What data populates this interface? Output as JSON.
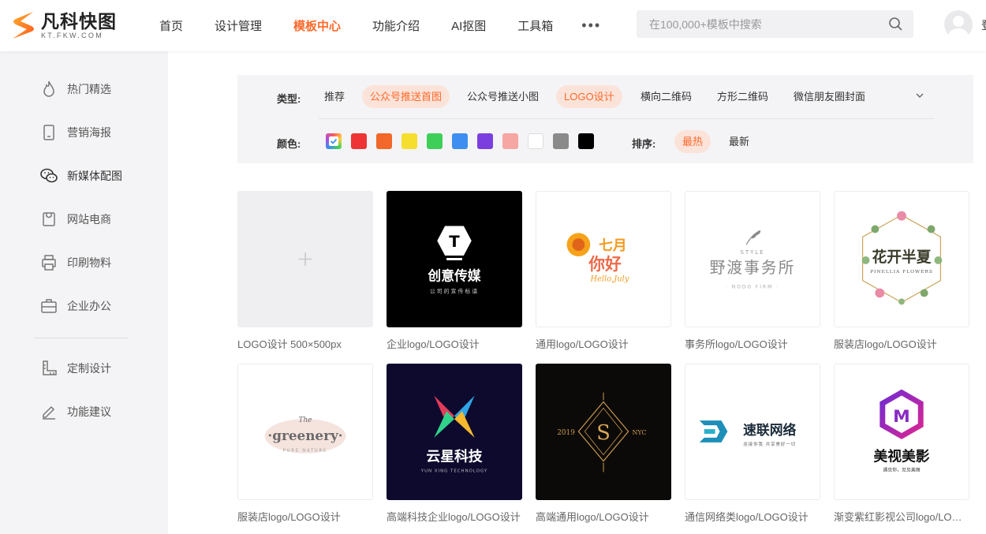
{
  "app": {
    "name": "凡科快图",
    "domain": "KT.FKW.COM",
    "brand_color": "#ff6a2b"
  },
  "nav": {
    "items": [
      "首页",
      "设计管理",
      "模板中心",
      "功能介绍",
      "AI抠图",
      "工具箱"
    ],
    "active": "模板中心",
    "more": "•••"
  },
  "search": {
    "placeholder": "在100,000+模板中搜索",
    "icon": "search-icon"
  },
  "header": {
    "tail_text": "登"
  },
  "sidebar": {
    "items": [
      {
        "label": "热门精选",
        "icon": "flame-icon"
      },
      {
        "label": "营销海报",
        "icon": "phone-icon"
      },
      {
        "label": "新媒体配图",
        "icon": "wechat-icon"
      },
      {
        "label": "网站电商",
        "icon": "shopping-bag-icon"
      },
      {
        "label": "印刷物料",
        "icon": "printer-icon"
      },
      {
        "label": "企业办公",
        "icon": "briefcase-icon"
      },
      {
        "label": "定制设计",
        "icon": "ruler-icon"
      },
      {
        "label": "功能建议",
        "icon": "pencil-icon"
      }
    ],
    "active": "新媒体配图"
  },
  "filters": {
    "type_label": "类型:",
    "types": [
      "推荐",
      "公众号推送首图",
      "公众号推送小图",
      "LOGO设计",
      "横向二维码",
      "方形二维码",
      "微信朋友圈封面"
    ],
    "selected_types": [
      "公众号推送首图",
      "LOGO设计"
    ],
    "color_label": "颜色:",
    "colors": [
      "multicolor",
      "#ee3434",
      "#f2672a",
      "#f6de2e",
      "#3ecf59",
      "#3d8ef0",
      "#7b3fe0",
      "#f6a6a3",
      "#ffffff",
      "#8a8a8a",
      "#000000"
    ],
    "sort_label": "排序:",
    "sorts": [
      "最热",
      "最新"
    ],
    "selected_sort": "最热"
  },
  "templates": [
    {
      "caption": "LOGO设计 500×500px",
      "kind": "blank"
    },
    {
      "caption": "企业logo/LOGO设计",
      "art_title": "创意传媒",
      "art_sub": "公司的宣传标语",
      "art_glyph": "T"
    },
    {
      "caption": "通用logo/LOGO设计",
      "art_title": "七月",
      "art_title2": "你好",
      "art_sub": "Hello,July"
    },
    {
      "caption": "事务所logo/LOGO设计",
      "art_top": "STYLE",
      "art_title": "野渡事务所",
      "art_sub": "· NODO FIRM ·"
    },
    {
      "caption": "服装店logo/LOGO设计",
      "art_title": "花开半夏",
      "art_sub": "PINELLIA FLOWERS"
    },
    {
      "caption": "服装店logo/LOGO设计",
      "art_top": "The",
      "art_title": "·greenery·",
      "art_sub": "PURE NATURE"
    },
    {
      "caption": "高端科技企业logo/LOGO设计",
      "art_title": "云星科技",
      "art_sub": "YUN XING TECHNOLOGY"
    },
    {
      "caption": "高端通用logo/LOGO设计",
      "art_glyph": "S",
      "art_left": "2019",
      "art_right": "NYC"
    },
    {
      "caption": "通信网络类logo/LOGO设计",
      "art_title": "速联网络",
      "art_sub": "连接你我 共享美好一切"
    },
    {
      "caption": "渐变紫红影视公司logo/LOGO设计",
      "art_glyph": "M",
      "art_title": "美视美影",
      "art_sub": "遇见你，见见美丽"
    }
  ]
}
